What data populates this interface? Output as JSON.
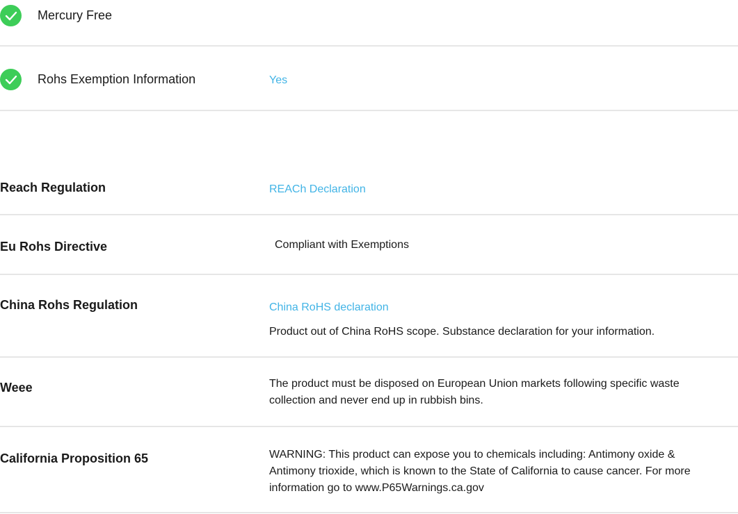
{
  "features": [
    {
      "label": "Mercury Free",
      "value": "",
      "icon": "check-circle-icon",
      "icon_color": "#3dcd58"
    },
    {
      "label": "Rohs Exemption Information",
      "value": "Yes",
      "icon": "check-circle-icon",
      "icon_color": "#3dcd58"
    }
  ],
  "regulations": {
    "reach": {
      "label": "Reach Regulation",
      "link": "REACh Declaration"
    },
    "eu_rohs": {
      "label": "Eu Rohs Directive",
      "value": "Compliant with Exemptions"
    },
    "china_rohs": {
      "label": "China Rohs Regulation",
      "link": "China RoHS declaration",
      "note": "Product out of China RoHS scope. Substance declaration for your information."
    },
    "weee": {
      "label": "Weee",
      "value": "The product must be disposed on European Union markets following specific waste collection and never end up in rubbish bins."
    },
    "prop65": {
      "label": "California Proposition 65",
      "value": "WARNING: This product can expose you to chemicals including: Antimony oxide & Antimony trioxide, which is known to the State of California to cause cancer. For more information go to www.P65Warnings.ca.gov"
    }
  },
  "colors": {
    "link": "#42b4e6",
    "check": "#3dcd58",
    "divider": "#e6e6e6",
    "text": "#1a1a1a"
  }
}
